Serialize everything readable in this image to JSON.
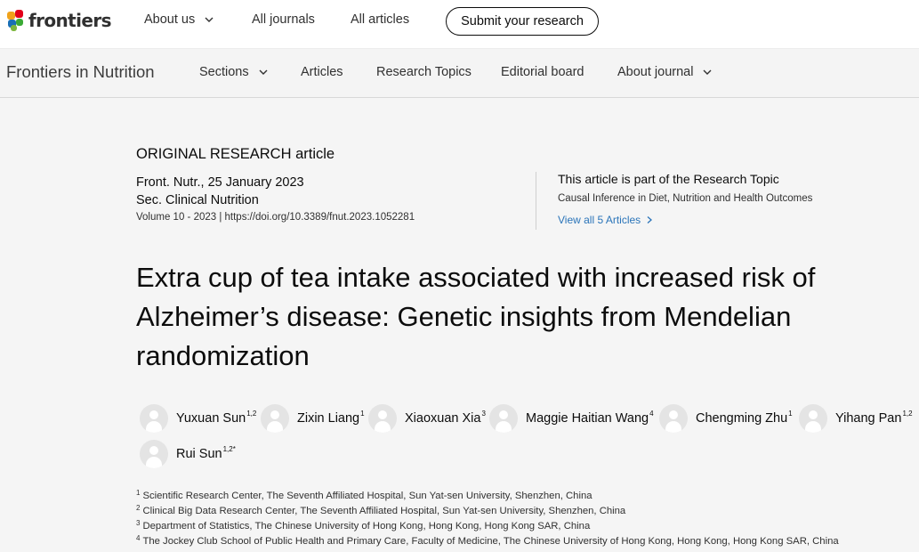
{
  "top_nav": {
    "logo_text": "frontiers",
    "items": [
      {
        "label": "About us"
      },
      {
        "label": "All journals"
      },
      {
        "label": "All articles"
      }
    ],
    "submit_label": "Submit your research"
  },
  "journal_nav": {
    "title": "Frontiers in Nutrition",
    "items": [
      {
        "label": "Sections"
      },
      {
        "label": "Articles"
      },
      {
        "label": "Research Topics"
      },
      {
        "label": "Editorial board"
      },
      {
        "label": "About journal"
      }
    ]
  },
  "article": {
    "type_label": "ORIGINAL RESEARCH article",
    "journal_date": "Front. Nutr., 25 January 2023",
    "section": "Sec. Clinical Nutrition",
    "volume_doi": "Volume 10 - 2023 | https://doi.org/10.3389/fnut.2023.1052281",
    "research_topic": {
      "label": "This article is part of the Research Topic",
      "name": "Causal Inference in Diet, Nutrition and Health Outcomes",
      "view_all": "View all 5 Articles"
    },
    "title_lines": [
      "Extra cup of tea intake associated with increased risk of",
      "Alzheimer’s disease: Genetic insights from Mendelian",
      "randomization"
    ],
    "authors": [
      {
        "name": "Yuxuan Sun",
        "sup": "1,2"
      },
      {
        "name": "Zixin Liang",
        "sup": "1"
      },
      {
        "name": "Xiaoxuan Xia",
        "sup": "3"
      },
      {
        "name": "Maggie Haitian Wang",
        "sup": "4"
      },
      {
        "name": "Chengming Zhu",
        "sup": "1"
      },
      {
        "name": "Yihang Pan",
        "sup": "1,2"
      },
      {
        "name": "Rui Sun",
        "sup": "1,2*"
      }
    ],
    "affiliations": [
      {
        "num": "1",
        "text": "Scientific Research Center, The Seventh Affiliated Hospital, Sun Yat-sen University, Shenzhen, China"
      },
      {
        "num": "2",
        "text": "Clinical Big Data Research Center, The Seventh Affiliated Hospital, Sun Yat-sen University, Shenzhen, China"
      },
      {
        "num": "3",
        "text": "Department of Statistics, The Chinese University of Hong Kong, Hong Kong, Hong Kong SAR, China"
      },
      {
        "num": "4",
        "text": "The Jockey Club School of Public Health and Primary Care, Faculty of Medicine, The Chinese University of Hong Kong, Hong Kong, Hong Kong SAR, China"
      }
    ]
  },
  "colors": {
    "link_blue": "#2a74b9",
    "text_dark": "#0c0c0c",
    "page_bg": "#f5f5f5"
  }
}
